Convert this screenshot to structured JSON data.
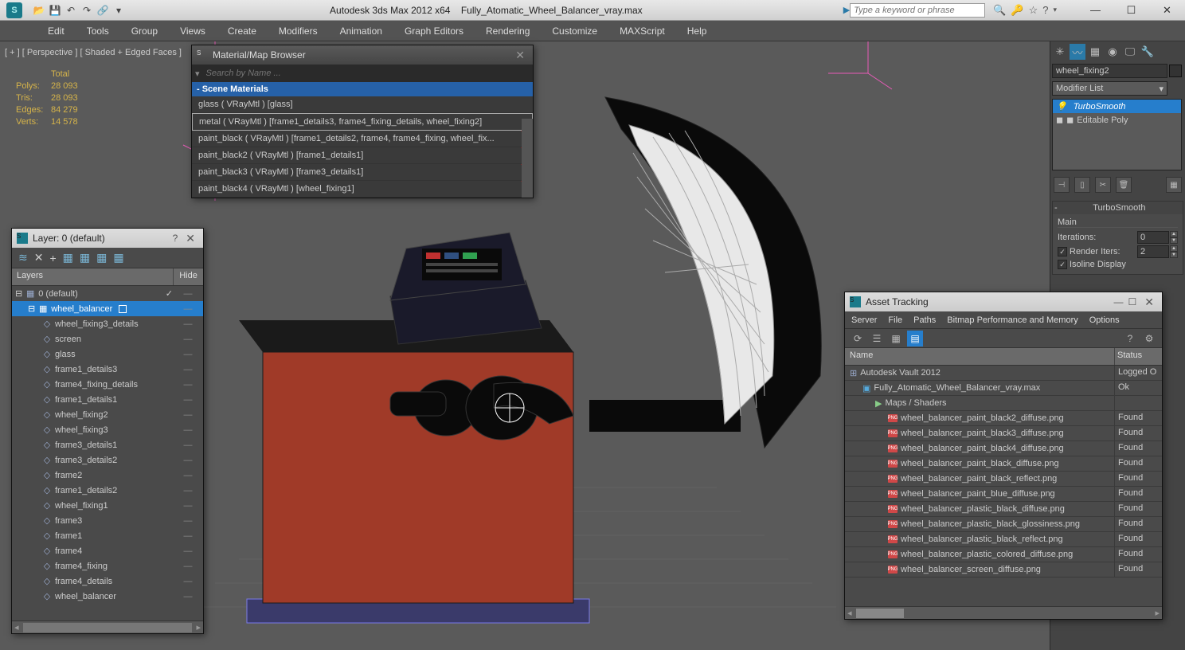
{
  "title": {
    "app": "Autodesk 3ds Max  2012 x64",
    "file": "Fully_Atomatic_Wheel_Balancer_vray.max",
    "search_placeholder": "Type a keyword or phrase"
  },
  "menu": [
    "Edit",
    "Tools",
    "Group",
    "Views",
    "Create",
    "Modifiers",
    "Animation",
    "Graph Editors",
    "Rendering",
    "Customize",
    "MAXScript",
    "Help"
  ],
  "viewport": {
    "label": "[ + ]  [ Perspective ]  [ Shaded + Edged Faces ]",
    "stats_header": "Total",
    "stats": [
      {
        "k": "Polys:",
        "v": "28 093"
      },
      {
        "k": "Tris:",
        "v": "28 093"
      },
      {
        "k": "Edges:",
        "v": "84 279"
      },
      {
        "k": "Verts:",
        "v": "14 578"
      }
    ]
  },
  "right_panel": {
    "object_name": "wheel_fixing2",
    "modifier_dropdown": "Modifier List",
    "stack": [
      {
        "label": "TurboSmooth",
        "sel": true,
        "icon": "💡"
      },
      {
        "label": "Editable Poly",
        "sel": false,
        "icon": "◼"
      }
    ],
    "rollout_title": "TurboSmooth",
    "main_label": "Main",
    "iterations_label": "Iterations:",
    "iterations_val": "0",
    "render_iters_label": "Render Iters:",
    "render_iters_val": "2",
    "isoline_label": "Isoline Display",
    "render_iters_checked": true,
    "isoline_checked": true
  },
  "material_browser": {
    "title": "Material/Map Browser",
    "search_placeholder": "Search by Name ...",
    "section": "- Scene Materials",
    "items": [
      {
        "label": "glass  ( VRayMtl )  [glass]",
        "sel": false,
        "flag": false
      },
      {
        "label": "metal  ( VRayMtl )  [frame1_details3, frame4_fixing_details, wheel_fixing2]",
        "sel": true,
        "flag": false
      },
      {
        "label": "paint_black  ( VRayMtl )  [frame1_details2, frame4, frame4_fixing, wheel_fix...",
        "sel": false,
        "flag": true
      },
      {
        "label": "paint_black2  ( VRayMtl )  [frame1_details1]",
        "sel": false,
        "flag": true
      },
      {
        "label": "paint_black3  ( VRayMtl )  [frame3_details1]",
        "sel": false,
        "flag": true
      },
      {
        "label": "paint_black4  ( VRayMtl )  [wheel_fixing1]",
        "sel": false,
        "flag": true
      }
    ]
  },
  "layer_dialog": {
    "title": "Layer: 0 (default)",
    "col_layers": "Layers",
    "col_hide": "Hide",
    "rows": [
      {
        "label": "0 (default)",
        "indent": 0,
        "sel": false,
        "check": "✓",
        "hide": "—",
        "icon": "▦"
      },
      {
        "label": "wheel_balancer",
        "indent": 1,
        "sel": true,
        "check": "□",
        "hide": "—",
        "icon": "▦"
      },
      {
        "label": "wheel_fixing3_details",
        "indent": 2,
        "sel": false,
        "hide": "—",
        "icon": "◇"
      },
      {
        "label": "screen",
        "indent": 2,
        "sel": false,
        "hide": "—",
        "icon": "◇"
      },
      {
        "label": "glass",
        "indent": 2,
        "sel": false,
        "hide": "—",
        "icon": "◇"
      },
      {
        "label": "frame1_details3",
        "indent": 2,
        "sel": false,
        "hide": "—",
        "icon": "◇"
      },
      {
        "label": "frame4_fixing_details",
        "indent": 2,
        "sel": false,
        "hide": "—",
        "icon": "◇"
      },
      {
        "label": "frame1_details1",
        "indent": 2,
        "sel": false,
        "hide": "—",
        "icon": "◇"
      },
      {
        "label": "wheel_fixing2",
        "indent": 2,
        "sel": false,
        "hide": "—",
        "icon": "◇"
      },
      {
        "label": "wheel_fixing3",
        "indent": 2,
        "sel": false,
        "hide": "—",
        "icon": "◇"
      },
      {
        "label": "frame3_details1",
        "indent": 2,
        "sel": false,
        "hide": "—",
        "icon": "◇"
      },
      {
        "label": "frame3_details2",
        "indent": 2,
        "sel": false,
        "hide": "—",
        "icon": "◇"
      },
      {
        "label": "frame2",
        "indent": 2,
        "sel": false,
        "hide": "—",
        "icon": "◇"
      },
      {
        "label": "frame1_details2",
        "indent": 2,
        "sel": false,
        "hide": "—",
        "icon": "◇"
      },
      {
        "label": "wheel_fixing1",
        "indent": 2,
        "sel": false,
        "hide": "—",
        "icon": "◇"
      },
      {
        "label": "frame3",
        "indent": 2,
        "sel": false,
        "hide": "—",
        "icon": "◇"
      },
      {
        "label": "frame1",
        "indent": 2,
        "sel": false,
        "hide": "—",
        "icon": "◇"
      },
      {
        "label": "frame4",
        "indent": 2,
        "sel": false,
        "hide": "—",
        "icon": "◇"
      },
      {
        "label": "frame4_fixing",
        "indent": 2,
        "sel": false,
        "hide": "—",
        "icon": "◇"
      },
      {
        "label": "frame4_details",
        "indent": 2,
        "sel": false,
        "hide": "—",
        "icon": "◇"
      },
      {
        "label": "wheel_balancer",
        "indent": 2,
        "sel": false,
        "hide": "—",
        "icon": "◇"
      }
    ]
  },
  "asset_dialog": {
    "title": "Asset Tracking",
    "menu": [
      "Server",
      "File",
      "Paths",
      "Bitmap Performance and Memory",
      "Options"
    ],
    "col_name": "Name",
    "col_status": "Status",
    "rows": [
      {
        "label": "Autodesk Vault 2012",
        "status": "Logged O",
        "indent": 0,
        "icon": "⊞",
        "type": "group"
      },
      {
        "label": "Fully_Atomatic_Wheel_Balancer_vray.max",
        "status": "Ok",
        "indent": 1,
        "icon": "▣",
        "type": "file"
      },
      {
        "label": "Maps / Shaders",
        "status": "",
        "indent": 2,
        "icon": "▶",
        "type": "group"
      },
      {
        "label": "wheel_balancer_paint_black2_diffuse.png",
        "status": "Found",
        "indent": 3,
        "icon": "png",
        "type": "png"
      },
      {
        "label": "wheel_balancer_paint_black3_diffuse.png",
        "status": "Found",
        "indent": 3,
        "icon": "png",
        "type": "png"
      },
      {
        "label": "wheel_balancer_paint_black4_diffuse.png",
        "status": "Found",
        "indent": 3,
        "icon": "png",
        "type": "png"
      },
      {
        "label": "wheel_balancer_paint_black_diffuse.png",
        "status": "Found",
        "indent": 3,
        "icon": "png",
        "type": "png"
      },
      {
        "label": "wheel_balancer_paint_black_reflect.png",
        "status": "Found",
        "indent": 3,
        "icon": "png",
        "type": "png"
      },
      {
        "label": "wheel_balancer_paint_blue_diffuse.png",
        "status": "Found",
        "indent": 3,
        "icon": "png",
        "type": "png"
      },
      {
        "label": "wheel_balancer_plastic_black_diffuse.png",
        "status": "Found",
        "indent": 3,
        "icon": "png",
        "type": "png"
      },
      {
        "label": "wheel_balancer_plastic_black_glossiness.png",
        "status": "Found",
        "indent": 3,
        "icon": "png",
        "type": "png"
      },
      {
        "label": "wheel_balancer_plastic_black_reflect.png",
        "status": "Found",
        "indent": 3,
        "icon": "png",
        "type": "png"
      },
      {
        "label": "wheel_balancer_plastic_colored_diffuse.png",
        "status": "Found",
        "indent": 3,
        "icon": "png",
        "type": "png"
      },
      {
        "label": "wheel_balancer_screen_diffuse.png",
        "status": "Found",
        "indent": 3,
        "icon": "png",
        "type": "png"
      }
    ]
  }
}
